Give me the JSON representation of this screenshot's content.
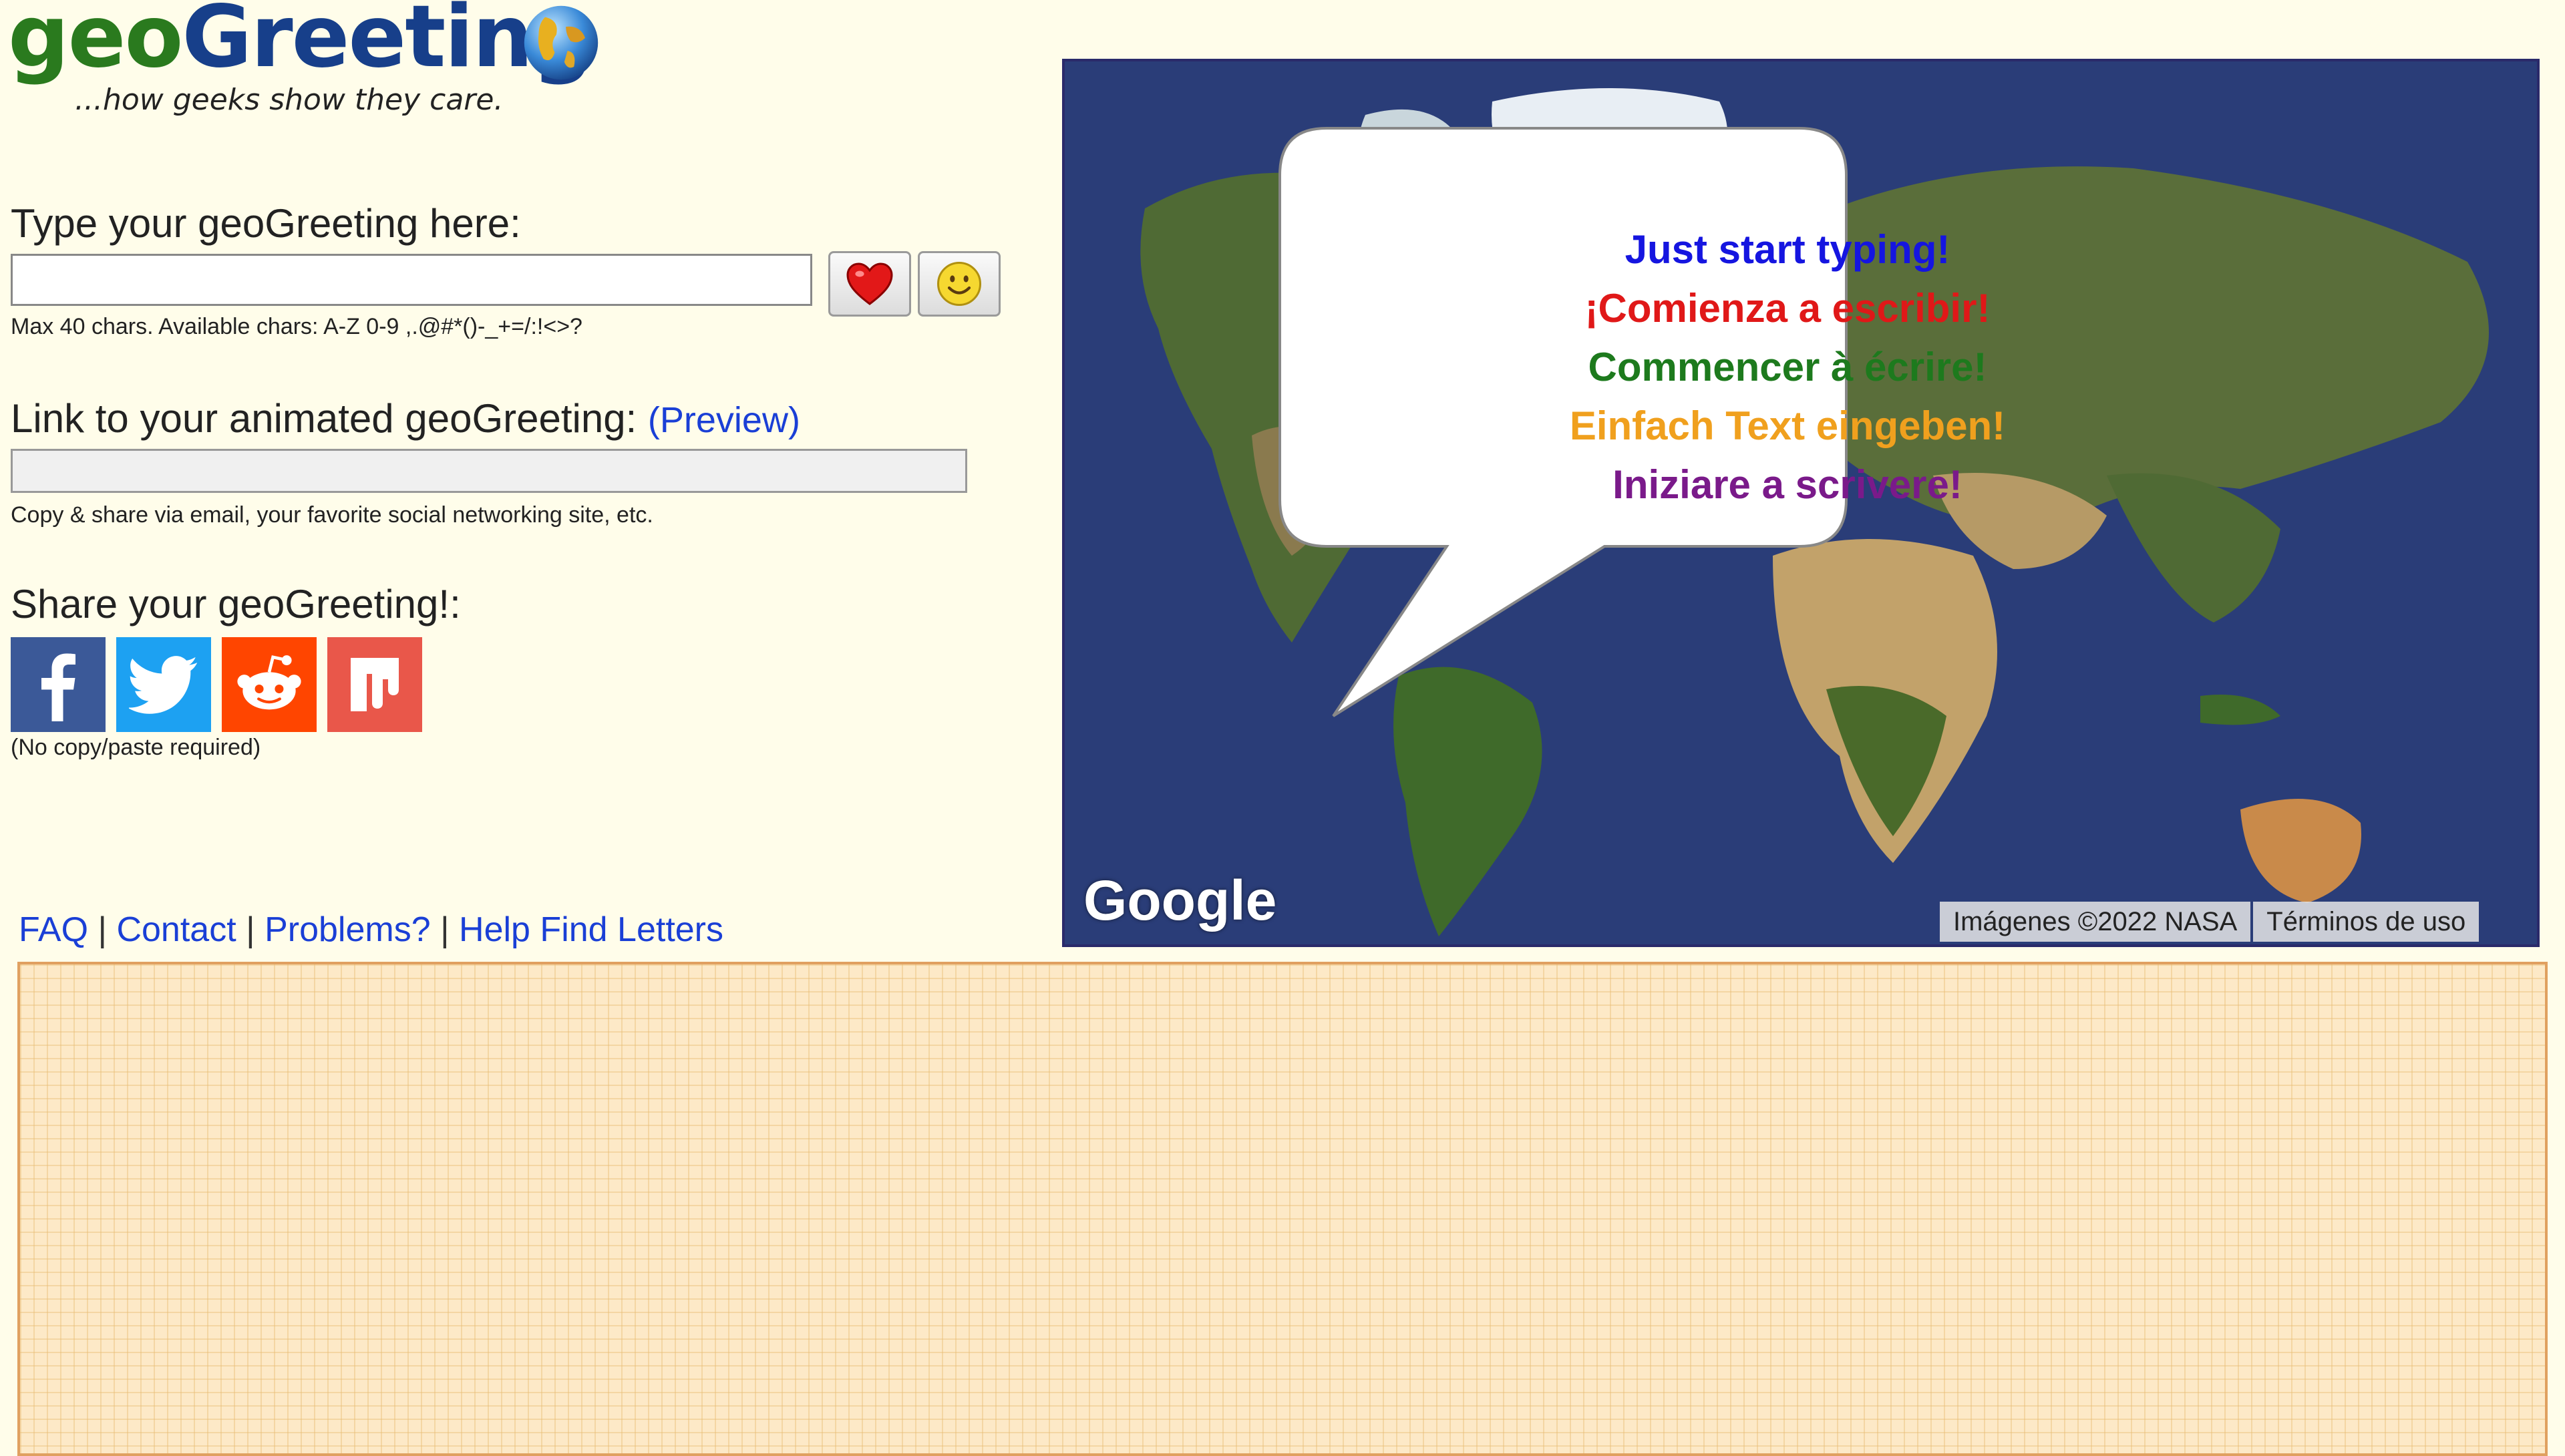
{
  "header": {
    "logo_part1": "geo",
    "logo_part2": "Greeting",
    "tagline": "...how geeks show they care."
  },
  "greeting": {
    "label": "Type your geoGreeting here:",
    "input_value": "",
    "hint": "Max 40 chars. Available chars: A-Z 0-9 ,.@#*()-_+=/:!<>?",
    "buttons": [
      "heart-icon",
      "smiley-icon"
    ]
  },
  "link": {
    "label": "Link to your animated geoGreeting: ",
    "preview": "(Preview)",
    "value": "",
    "hint": "Copy & share via email, your favorite social networking site, etc."
  },
  "share": {
    "label": "Share your geoGreeting!:",
    "icons": [
      "facebook-icon",
      "twitter-icon",
      "reddit-icon",
      "mix-icon"
    ],
    "note": "(No copy/paste required)"
  },
  "footer": {
    "links": [
      "FAQ",
      "Contact",
      "Problems?",
      "Help Find Letters"
    ],
    "separator": " | "
  },
  "map": {
    "bubble_lines": [
      "Just start typing!",
      "¡Comienza a escribir!",
      "Commencer à écrire!",
      "Einfach Text eingeben!",
      "Iniziare a scrivere!"
    ],
    "bubble_colors": [
      "#1515e0",
      "#e01818",
      "#1d7a1d",
      "#f0a01e",
      "#7a1a8a"
    ],
    "google_logo": "Google",
    "imagery_credit": "Imágenes ©2022 NASA",
    "terms": "Términos de uso"
  },
  "colors": {
    "page_bg": "#fffdea",
    "link": "#1a3fd6",
    "grid_bg": "#fde9c7"
  }
}
